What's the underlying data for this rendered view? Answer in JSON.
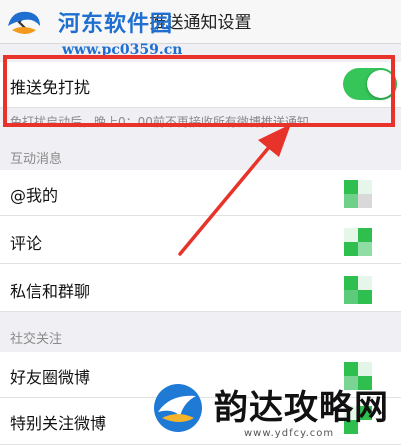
{
  "navbar": {
    "title": "推送通知设置"
  },
  "watermark": {
    "name": "河东软件园",
    "url": "www.pc0359.cn"
  },
  "do_not_disturb": {
    "label": "推送免打扰",
    "enabled": true,
    "hint": "免打扰启动后，晚上0：00前不再接收所有微博推送通知"
  },
  "sections": [
    {
      "header": "互动消息",
      "items": [
        "@我的",
        "评论",
        "私信和群聊"
      ]
    },
    {
      "header": "社交关注",
      "items": [
        "好友圈微博",
        "特别关注微博"
      ]
    }
  ],
  "brand": {
    "name": "韵达攻略网",
    "url": "www.ydfcy.com"
  },
  "colors": {
    "toggle_on": "#35c559",
    "highlight": "#e8332a",
    "mosaic": "#2fbf4f"
  }
}
